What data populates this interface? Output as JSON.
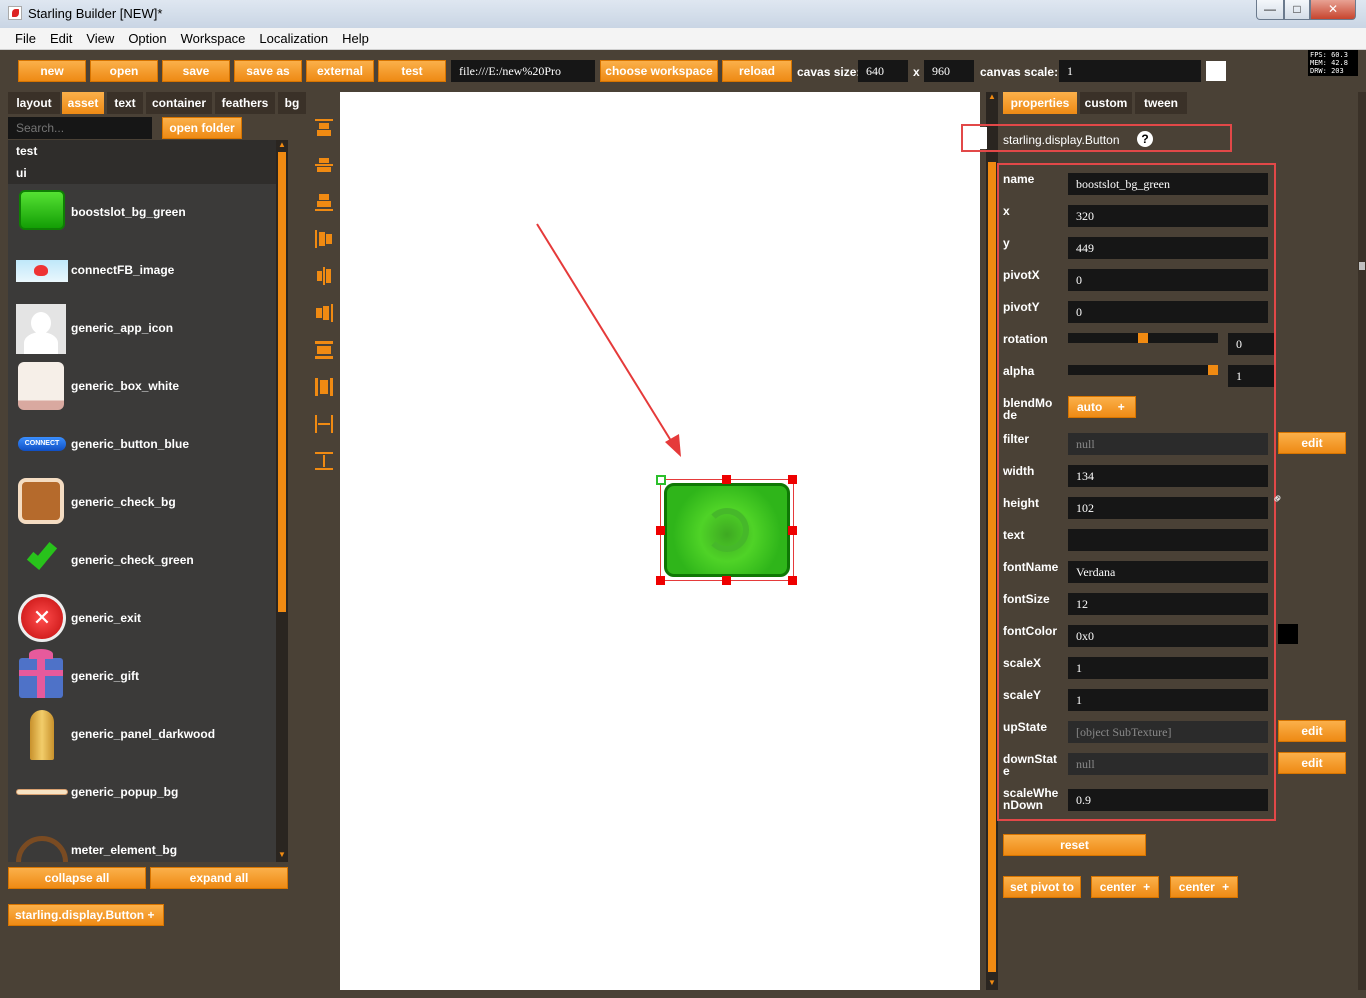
{
  "window": {
    "title": "Starling Builder [NEW]*",
    "min": "—",
    "max": "□",
    "close": "✕"
  },
  "menu": [
    "File",
    "Edit",
    "View",
    "Option",
    "Workspace",
    "Localization",
    "Help"
  ],
  "toolbar": {
    "new": "new",
    "open": "open",
    "save": "save",
    "save_as": "save as",
    "external": "external",
    "test": "test",
    "path": "file:///E:/new%20Pro",
    "choose_workspace": "choose workspace",
    "reload": "reload",
    "canvas_size_label": "cavas size:",
    "canvas_w": "640",
    "x_sep": "x",
    "canvas_h": "960",
    "canvas_scale_label": "canvas scale:",
    "canvas_scale": "1"
  },
  "stats": {
    "fps": "FPS: 60.3",
    "mem": "MEM: 42.8",
    "drw": "DRW: 203"
  },
  "left_tabs": [
    "layout",
    "asset",
    "text",
    "container",
    "feathers",
    "bg"
  ],
  "search": {
    "placeholder": "Search..."
  },
  "open_folder": "open folder",
  "folders": [
    "test",
    "ui"
  ],
  "assets": [
    "boostslot_bg_green",
    "connectFB_image",
    "generic_app_icon",
    "generic_box_white",
    "generic_button_blue",
    "generic_check_bg",
    "generic_check_green",
    "generic_exit",
    "generic_gift",
    "generic_panel_darkwood",
    "generic_popup_bg",
    "meter_element_bg"
  ],
  "connect_text": "CONNECT",
  "collapse_all": "collapse all",
  "expand_all": "expand all",
  "create_type": "starling.display.Button",
  "right_tabs": [
    "properties",
    "custom",
    "tween"
  ],
  "class_name": "starling.display.Button",
  "help": "?",
  "plus": "+",
  "props": {
    "name": {
      "label": "name",
      "value": "boostslot_bg_green"
    },
    "x": {
      "label": "x",
      "value": "320"
    },
    "y": {
      "label": "y",
      "value": "449"
    },
    "pivotX": {
      "label": "pivotX",
      "value": "0"
    },
    "pivotY": {
      "label": "pivotY",
      "value": "0"
    },
    "rotation": {
      "label": "rotation",
      "value": "0",
      "slider": 0.5
    },
    "alpha": {
      "label": "alpha",
      "value": "1",
      "slider": 1.0
    },
    "blendMode": {
      "label": "blendMo de",
      "value": "auto"
    },
    "filter": {
      "label": "filter",
      "value": "null",
      "edit": "edit"
    },
    "width": {
      "label": "width",
      "value": "134"
    },
    "height": {
      "label": "height",
      "value": "102"
    },
    "text": {
      "label": "text",
      "value": ""
    },
    "fontName": {
      "label": "fontName",
      "value": "Verdana"
    },
    "fontSize": {
      "label": "fontSize",
      "value": "12"
    },
    "fontColor": {
      "label": "fontColor",
      "value": "0x0",
      "swatch": "#000000"
    },
    "scaleX": {
      "label": "scaleX",
      "value": "1"
    },
    "scaleY": {
      "label": "scaleY",
      "value": "1"
    },
    "upState": {
      "label": "upState",
      "value": "[object SubTexture]",
      "edit": "edit"
    },
    "downState": {
      "label": "downStat e",
      "value": "null",
      "edit": "edit"
    },
    "scaleWhenDown": {
      "label": "scaleWhe nDown",
      "value": "0.9"
    }
  },
  "reset": "reset",
  "set_pivot_to": "set pivot to",
  "center1": "center",
  "center2": "center",
  "colors": {
    "accent": "#f08a12",
    "panel": "#4a4136",
    "field": "#161616",
    "highlight": "#e24848"
  }
}
